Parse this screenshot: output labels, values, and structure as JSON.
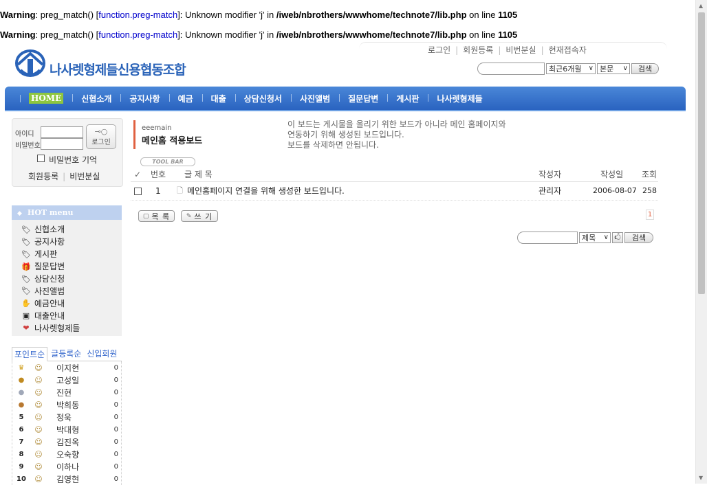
{
  "warnings": [
    {
      "prefix": "Warning",
      "text1": ": preg_match() [",
      "fn": "function.preg-match",
      "text2": "]: Unknown modifier 'j' in ",
      "path": "/iweb/nbrothers/wwwhome/technote7/lib.php",
      "text3": " on line ",
      "line": "1105"
    },
    {
      "prefix": "Warning",
      "text1": ": preg_match() [",
      "fn": "function.preg-match",
      "text2": "]: Unknown modifier 'j' in ",
      "path": "/iweb/nbrothers/wwwhome/technote7/lib.php",
      "text3": " on line ",
      "line": "1105"
    }
  ],
  "toplinks": [
    "로그인",
    "회원등록",
    "비번분실",
    "현재접속자"
  ],
  "logo": {
    "text": "나사렛형제들신용협동조합"
  },
  "header_search": {
    "period": "최근6개월",
    "field": "본문",
    "button": "검색"
  },
  "nav": [
    "HOME",
    "신협소개",
    "공지사항",
    "예금",
    "대출",
    "상담신청서",
    "사진앨범",
    "질문답변",
    "게시판",
    "나사렛형제들"
  ],
  "login": {
    "id_label": "아이디",
    "pw_label": "비밀번호",
    "button": "로그인",
    "remember": "비밀번호 기억",
    "join": "회원등록",
    "lost": "비번분실"
  },
  "hot_menu": {
    "title": "HOT menu",
    "items": [
      {
        "label": "신협소개",
        "icon": "tag-icon"
      },
      {
        "label": "공지사항",
        "icon": "tag-icon"
      },
      {
        "label": "게시판",
        "icon": "tag-icon"
      },
      {
        "label": "질문답변",
        "icon": "gift-icon"
      },
      {
        "label": "상담신청",
        "icon": "tag-icon"
      },
      {
        "label": "사진앨범",
        "icon": "tag-icon"
      },
      {
        "label": "예금안내",
        "icon": "hand-icon"
      },
      {
        "label": "대출안내",
        "icon": "card-icon"
      },
      {
        "label": "나사렛형제들",
        "icon": "heart-icon"
      }
    ]
  },
  "ranking": {
    "tabs": [
      "포인트순",
      "글등록순",
      "신입회원"
    ],
    "rows": [
      {
        "rank": "",
        "badge": "crown",
        "name": "이지현",
        "points": "0"
      },
      {
        "rank": "",
        "badge": "medal",
        "name": "고성일",
        "points": "0"
      },
      {
        "rank": "",
        "badge": "medal",
        "name": "진현",
        "points": "0"
      },
      {
        "rank": "",
        "badge": "medal",
        "name": "박희동",
        "points": "0"
      },
      {
        "rank": "5",
        "badge": "",
        "name": "정욱",
        "points": "0"
      },
      {
        "rank": "6",
        "badge": "",
        "name": "박대형",
        "points": "0"
      },
      {
        "rank": "7",
        "badge": "",
        "name": "김진옥",
        "points": "0"
      },
      {
        "rank": "8",
        "badge": "",
        "name": "오숙향",
        "points": "0"
      },
      {
        "rank": "9",
        "badge": "",
        "name": "이하나",
        "points": "0"
      },
      {
        "rank": "10",
        "badge": "",
        "name": "김영현",
        "points": "0"
      }
    ]
  },
  "board": {
    "id": "eeemain",
    "name": "메인홈 적용보드",
    "description": [
      "이 보드는 게시물을 올리기 위한 보드가 아니라 메인 홈페이지와",
      "연동하기 위해 생성된 보드입니다.",
      "보드를 삭제하면 안됩니다."
    ],
    "toolbar": "TOOL BAR",
    "columns": {
      "check": "✓",
      "no": "번호",
      "title": "글 제 목",
      "author": "작성자",
      "date": "작성일",
      "views": "조회"
    },
    "rows": [
      {
        "no": "1",
        "title": "메인홈페이지 연결을 위해 생성한 보드입니다.",
        "author": "관리자",
        "date": "2006-08-07",
        "views": "258"
      }
    ],
    "page": "1",
    "list_button": "목 록",
    "write_button": "쓰 기",
    "search_field": "제목",
    "search_button": "검색"
  }
}
